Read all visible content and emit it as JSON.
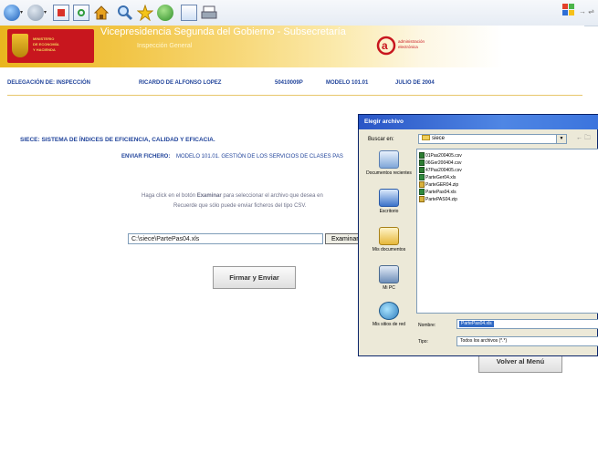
{
  "banner": {
    "ministry_lines": [
      "MINISTERIO",
      "DE ECONOMÍA",
      "Y HACIENDA"
    ],
    "title": "Vicepresidencia Segunda del Gobierno - Subsecretaría",
    "subtitle": "Inspección General",
    "ae_logo_lines": [
      "administración",
      "electrónica"
    ]
  },
  "info_bar": {
    "delegation": "DELEGACIÓN DE:  INSPECCIÓN",
    "user": "RICARDO DE ALFONSO LOPEZ",
    "code": "50410009P",
    "model": "MODELO 101.01",
    "date": "JULIO DE 2004"
  },
  "main": {
    "title": "SIECE: SISTEMA DE ÍNDICES DE EFICIENCIA, CALIDAD Y EFICACIA.",
    "enviar_label": "ENVIAR FICHERO:",
    "enviar_desc": "MODELO 101.01. GESTIÓN DE LOS SERVICIOS DE CLASES PAS",
    "help_line1_a": "Haga click en el botón ",
    "help_line1_b": "Examinar",
    "help_line1_c": " para seleccionar el archivo que desea en",
    "help_line2": "Recuerde que sólo puede enviar ficheros del tipo CSV.",
    "file_value": "C:\\siece\\PartePas04.xls",
    "browse_label": "Examinar...",
    "submit_label": "Firmar y Enviar",
    "back_label": "Volver al Menú"
  },
  "dialog": {
    "title": "Elegir archivo",
    "buscar_label": "Buscar en:",
    "folder": "siece",
    "places": [
      "Documentos recientes",
      "Escritorio",
      "Mis documentos",
      "Mi PC",
      "Mis sitios de red"
    ],
    "files": [
      {
        "name": "01Pas200405.csv",
        "kind": "csv"
      },
      {
        "name": "06Ger200404.csv",
        "kind": "csv"
      },
      {
        "name": "47Pas200405.csv",
        "kind": "csv"
      },
      {
        "name": "ParteGer04.xls",
        "kind": "xls"
      },
      {
        "name": "ParteGER04.zip",
        "kind": "zip"
      },
      {
        "name": "PartePas04.xls",
        "kind": "xls"
      },
      {
        "name": "PartePAS04.zip",
        "kind": "zip"
      }
    ],
    "nombre_label": "Nombre:",
    "nombre_value": "PartePas04.xls",
    "tipo_label": "Tipo:",
    "tipo_value": "Todos los archivos (*.*)"
  }
}
